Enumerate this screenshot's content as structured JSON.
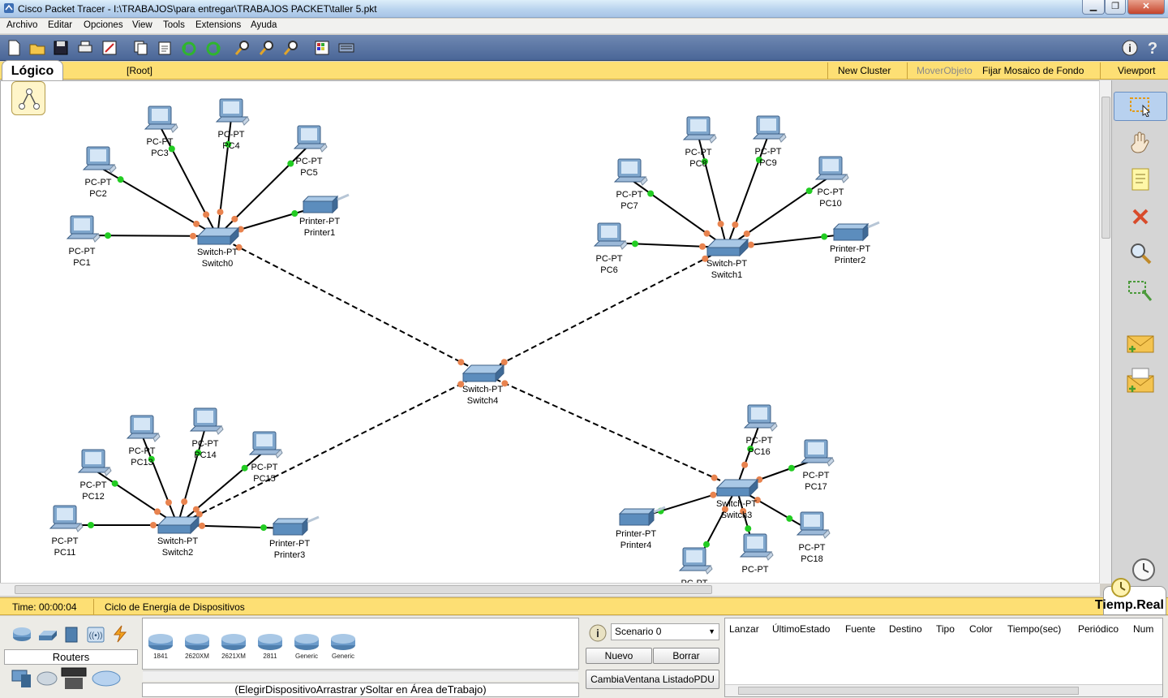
{
  "window": {
    "title": "Cisco Packet Tracer - I:\\TRABAJOS\\para entregar\\TRABAJOS PACKET\\taller 5.pkt"
  },
  "menu": [
    "Archivo",
    "Editar",
    "Opciones",
    "View",
    "Tools",
    "Extensions",
    "Ayuda"
  ],
  "logic_bar": {
    "tab": "Lógico",
    "root": "[Root]",
    "new_cluster": "New Cluster",
    "move_object": "MoverObjeto",
    "set_background": "Fijar Mosaico de Fondo",
    "viewport": "Viewport"
  },
  "devices": [
    {
      "id": "PC1",
      "type": "PC-PT",
      "name": "PC1"
    },
    {
      "id": "PC2",
      "type": "PC-PT",
      "name": "PC2"
    },
    {
      "id": "PC3",
      "type": "PC-PT",
      "name": "PC3"
    },
    {
      "id": "PC4",
      "type": "PC-PT",
      "name": "PC4"
    },
    {
      "id": "PC5",
      "type": "PC-PT",
      "name": "PC5"
    },
    {
      "id": "Printer1",
      "type": "Printer-PT",
      "name": "Printer1"
    },
    {
      "id": "Switch0",
      "type": "Switch-PT",
      "name": "Switch0"
    },
    {
      "id": "PC6",
      "type": "PC-PT",
      "name": "PC6"
    },
    {
      "id": "PC7",
      "type": "PC-PT",
      "name": "PC7"
    },
    {
      "id": "PC8",
      "type": "PC-PT",
      "name": "PC8"
    },
    {
      "id": "PC9",
      "type": "PC-PT",
      "name": "PC9"
    },
    {
      "id": "PC10",
      "type": "PC-PT",
      "name": "PC10"
    },
    {
      "id": "Printer2",
      "type": "Printer-PT",
      "name": "Printer2"
    },
    {
      "id": "Switch1",
      "type": "Switch-PT",
      "name": "Switch1"
    },
    {
      "id": "Switch4",
      "type": "Switch-PT",
      "name": "Switch4"
    },
    {
      "id": "PC11",
      "type": "PC-PT",
      "name": "PC11"
    },
    {
      "id": "PC12",
      "type": "PC-PT",
      "name": "PC12"
    },
    {
      "id": "PC13",
      "type": "PC-PT",
      "name": "PC13"
    },
    {
      "id": "PC14",
      "type": "PC-PT",
      "name": "PC14"
    },
    {
      "id": "PC15",
      "type": "PC-PT",
      "name": "PC15"
    },
    {
      "id": "Printer3",
      "type": "Printer-PT",
      "name": "Printer3"
    },
    {
      "id": "Switch2",
      "type": "Switch-PT",
      "name": "Switch2"
    },
    {
      "id": "PC16",
      "type": "PC-PT",
      "name": "PC16"
    },
    {
      "id": "PC17",
      "type": "PC-PT",
      "name": "PC17"
    },
    {
      "id": "PC18",
      "type": "PC-PT",
      "name": "PC18"
    },
    {
      "id": "PC19",
      "type": "PC-PT",
      "name": ""
    },
    {
      "id": "PC20",
      "type": "PC-PT",
      "name": ""
    },
    {
      "id": "Printer4",
      "type": "Printer-PT",
      "name": "Printer4"
    },
    {
      "id": "Switch3",
      "type": "Switch-PT",
      "name": "Switch3"
    }
  ],
  "links": [
    {
      "from": "PC1",
      "to": "Switch0",
      "style": "straight"
    },
    {
      "from": "PC2",
      "to": "Switch0",
      "style": "straight"
    },
    {
      "from": "PC3",
      "to": "Switch0",
      "style": "straight"
    },
    {
      "from": "PC4",
      "to": "Switch0",
      "style": "straight"
    },
    {
      "from": "PC5",
      "to": "Switch0",
      "style": "straight"
    },
    {
      "from": "Printer1",
      "to": "Switch0",
      "style": "straight"
    },
    {
      "from": "PC6",
      "to": "Switch1",
      "style": "straight"
    },
    {
      "from": "PC7",
      "to": "Switch1",
      "style": "straight"
    },
    {
      "from": "PC8",
      "to": "Switch1",
      "style": "straight"
    },
    {
      "from": "PC9",
      "to": "Switch1",
      "style": "straight"
    },
    {
      "from": "PC10",
      "to": "Switch1",
      "style": "straight"
    },
    {
      "from": "Printer2",
      "to": "Switch1",
      "style": "straight"
    },
    {
      "from": "PC11",
      "to": "Switch2",
      "style": "straight"
    },
    {
      "from": "PC12",
      "to": "Switch2",
      "style": "straight"
    },
    {
      "from": "PC13",
      "to": "Switch2",
      "style": "straight"
    },
    {
      "from": "PC14",
      "to": "Switch2",
      "style": "straight"
    },
    {
      "from": "PC15",
      "to": "Switch2",
      "style": "straight"
    },
    {
      "from": "Printer3",
      "to": "Switch2",
      "style": "straight"
    },
    {
      "from": "PC16",
      "to": "Switch3",
      "style": "straight"
    },
    {
      "from": "PC17",
      "to": "Switch3",
      "style": "straight"
    },
    {
      "from": "PC18",
      "to": "Switch3",
      "style": "straight"
    },
    {
      "from": "PC19",
      "to": "Switch3",
      "style": "straight"
    },
    {
      "from": "PC20",
      "to": "Switch3",
      "style": "straight"
    },
    {
      "from": "Printer4",
      "to": "Switch3",
      "style": "straight"
    },
    {
      "from": "Switch0",
      "to": "Switch4",
      "style": "crossover"
    },
    {
      "from": "Switch1",
      "to": "Switch4",
      "style": "crossover"
    },
    {
      "from": "Switch2",
      "to": "Switch4",
      "style": "crossover"
    },
    {
      "from": "Switch3",
      "to": "Switch4",
      "style": "crossover"
    }
  ],
  "colors": {
    "link_up": "#22cc22",
    "port_switch": "#e8834f",
    "bar": "#fddf74",
    "toolbar": "#4a6697"
  },
  "time_bar": {
    "time": "Time: 00:00:04",
    "cycle": "Ciclo de Energía de Dispositivos",
    "realtime": "Tiemp.Real"
  },
  "device_panel": {
    "category": "Routers",
    "models": [
      "1841",
      "2620XM",
      "2621XM",
      "2811",
      "Generic",
      "Generic"
    ],
    "hint": "(ElegirDispositivoArrastrar ySoltar en Área deTrabajo)"
  },
  "scenario": {
    "selected": "Scenario 0",
    "new": "Nuevo",
    "delete": "Borrar",
    "toggle": "CambiaVentana ListadoPDU"
  },
  "pdu_columns": [
    "Lanzar",
    "ÚltimoEstado",
    "Fuente",
    "Destino",
    "Tipo",
    "Color",
    "Tiempo(sec)",
    "Periódico",
    "Num"
  ]
}
